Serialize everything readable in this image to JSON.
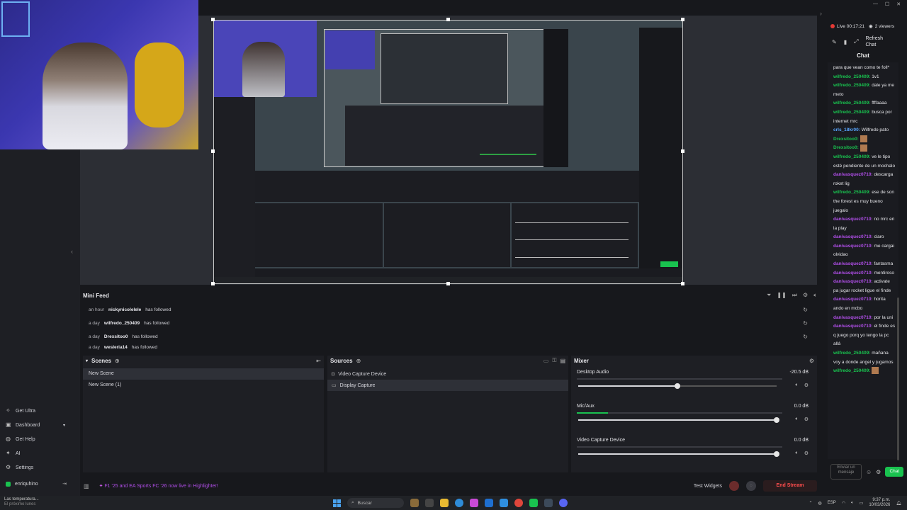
{
  "window": {
    "minimize": "—",
    "maximize": "☐",
    "close": "✕"
  },
  "live": {
    "timer": "Live 00:17:21",
    "viewers": "2 viewers"
  },
  "chat_tools": {
    "refresh": "Refresh\nChat"
  },
  "chat": {
    "title": "Chat",
    "messages": [
      {
        "user": "",
        "text": "para que vean como te foll*",
        "color": "none"
      },
      {
        "user": "wilfredo_250409:",
        "text": " 1v1",
        "color": "g"
      },
      {
        "user": "wilfredo_250409:",
        "text": " dale ya me meto",
        "color": "g"
      },
      {
        "user": "wilfredo_250409:",
        "text": " ffffaaaa",
        "color": "g"
      },
      {
        "user": "wilfredo_250409:",
        "text": " busca por internet mrc",
        "color": "g"
      },
      {
        "user": "crls_18kr00:",
        "text": " Wilfredo pato",
        "color": "b"
      },
      {
        "user": "Drexsitoo0:",
        "text": " ",
        "color": "g",
        "emote": true
      },
      {
        "user": "Drexsitoo0:",
        "text": " ",
        "color": "g",
        "emote": true
      },
      {
        "user": "wilfredo_250409:",
        "text": " ve le tipo esté pendiente de un mochalo",
        "color": "g"
      },
      {
        "user": "danivasquez0710:",
        "text": " descarga roket lig",
        "color": "p"
      },
      {
        "user": "wilfredo_250409:",
        "text": " ese de son the forest es muy bueno juegalo",
        "color": "g"
      },
      {
        "user": "danivasquez0710:",
        "text": " no mrc en la play",
        "color": "p"
      },
      {
        "user": "danivasquez0710:",
        "text": " claro",
        "color": "p"
      },
      {
        "user": "danivasquez0710:",
        "text": " me cargai olvidao",
        "color": "p"
      },
      {
        "user": "danivasquez0710:",
        "text": " fantasma",
        "color": "p"
      },
      {
        "user": "danivasquez0710:",
        "text": " mentiroso",
        "color": "p"
      },
      {
        "user": "danivasquez0710:",
        "text": " activate pa jugar rocket ligue el finde",
        "color": "p"
      },
      {
        "user": "danivasquez0710:",
        "text": " horita ando en mcbo",
        "color": "p"
      },
      {
        "user": "danivasquez0710:",
        "text": " por la uni",
        "color": "p"
      },
      {
        "user": "danivasquez0710:",
        "text": " el finde es q juego porq yo tengo la pc allá",
        "color": "p"
      },
      {
        "user": "wilfredo_250409:",
        "text": " mañana voy a donde angel y jugamos",
        "color": "g"
      },
      {
        "user": "wilfredo_250409:",
        "text": " ",
        "color": "g",
        "emote": true
      }
    ],
    "input_placeholder": "Enviar un mensaje",
    "send_label": "Chat"
  },
  "sidebar": {
    "items": [
      {
        "label": "Get Ultra",
        "icon": "ultra-icon"
      },
      {
        "label": "Dashboard",
        "icon": "dashboard-icon"
      },
      {
        "label": "Get Help",
        "icon": "help-icon"
      },
      {
        "label": "AI",
        "icon": "ai-icon"
      },
      {
        "label": "Settings",
        "icon": "settings-icon"
      }
    ],
    "user": "enriquhino"
  },
  "minifeed": {
    "title": "Mini Feed",
    "rows": [
      {
        "time": "an hour",
        "name": "nickynicolelele",
        "action": "has followed"
      },
      {
        "time": "a day",
        "name": "wilfredo_250409",
        "action": "has followed"
      },
      {
        "time": "a day",
        "name": "Drexsitoo0",
        "action": "has followed"
      },
      {
        "time": "a day",
        "name": "wesleria14",
        "action": "has followed"
      }
    ]
  },
  "scenes": {
    "title": "Scenes",
    "items": [
      "New Scene",
      "New Scene (1)"
    ]
  },
  "sources": {
    "title": "Sources",
    "items": [
      "Video Capture Device",
      "Display Capture"
    ]
  },
  "mixer": {
    "title": "Mixer",
    "channels": [
      {
        "name": "Desktop Audio",
        "db": "-20.5 dB",
        "level": 0.0,
        "volume": 0.5
      },
      {
        "name": "Mic/Aux",
        "db": "0.0 dB",
        "level": 0.15,
        "volume": 1.0
      },
      {
        "name": "Video Capture Device",
        "db": "0.0 dB",
        "level": 0.0,
        "volume": 1.0
      }
    ]
  },
  "statusbar": {
    "promo": "F1 '25 and EA Sports FC '26 now live in Highlighter!",
    "test_widgets": "Test Widgets",
    "end_stream": "End Stream"
  },
  "taskbar": {
    "weather_line1": "Las temperatura...",
    "weather_line2": "El próximo lunes",
    "search_placeholder": "Buscar",
    "lang": "ESP",
    "time": "9:37 p.m.",
    "date": "10/03/2026"
  },
  "colors": {
    "accent": "#19c24f",
    "promo": "#b04ee8",
    "danger": "#ff4d4d"
  }
}
